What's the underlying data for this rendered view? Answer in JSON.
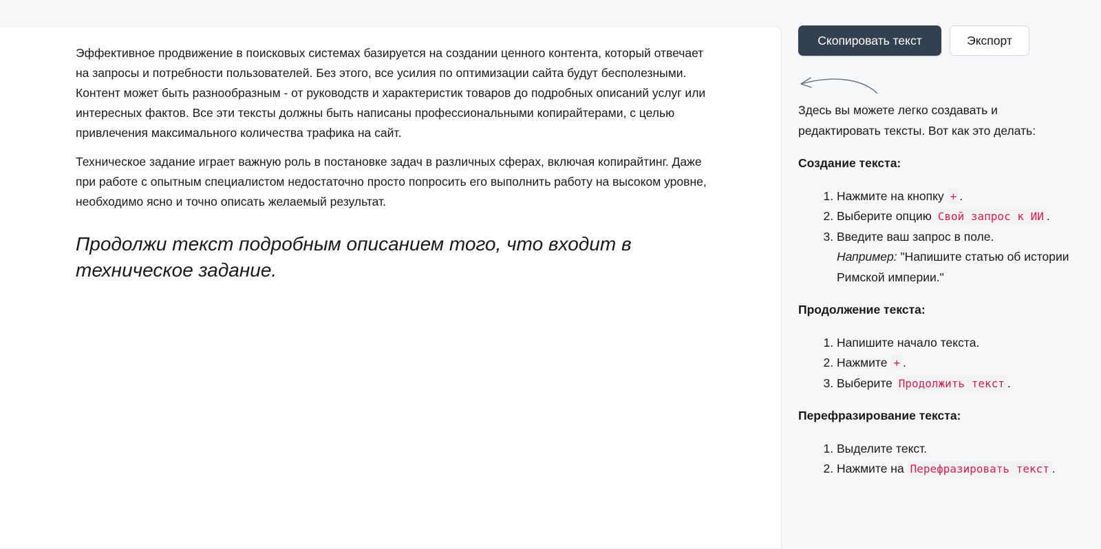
{
  "editor": {
    "paragraphs": [
      "Эффективное продвижение в поисковых системах базируется на создании ценного контента, который отвечает на запросы и потребности пользователей. Без этого, все усилия по оптимизации сайта будут бесполезными. Контент может быть разнообразным - от руководств и характеристик товаров до подробных описаний услуг или интересных фактов. Все эти тексты должны быть написаны профессиональными копирайтерами, с целью привлечения максимального количества трафика на сайт.",
      "Техническое задание играет важную роль в постановке задач в различных сферах, включая копирайтинг. Даже при работе с опытным специалистом недостаточно просто попросить его выполнить работу на высоком уровне, необходимо ясно и точно описать желаемый результат."
    ],
    "prompt": "Продолжи текст подробным описанием того, что входит в техническое задание."
  },
  "toolbar": {
    "copy_label": "Скопировать текст",
    "export_label": "Экспорт",
    "copy_color": "#334050"
  },
  "help": {
    "intro": "Здесь вы можете легко создавать и редактировать тексты. Вот как это делать:",
    "sections": [
      {
        "title": "Создание текста:",
        "steps": [
          {
            "before": "Нажмите на кнопку ",
            "code": "+",
            "after": "."
          },
          {
            "before": "Выберите опцию ",
            "code": "Свой запрос к ИИ",
            "after": "."
          },
          {
            "before": "Введите ваш запрос в поле.",
            "example_label": "Например:",
            "example_text": " \"Напишите статью об истории Римской империи.\""
          }
        ]
      },
      {
        "title": "Продолжение текста:",
        "steps": [
          {
            "before": "Напишите начало текста."
          },
          {
            "before": "Нажмите ",
            "code": "+",
            "after": "."
          },
          {
            "before": "Выберите ",
            "code": "Продолжить текст",
            "after": "."
          }
        ]
      },
      {
        "title": "Перефразирование текста:",
        "steps": [
          {
            "before": "Выделите текст."
          },
          {
            "before": "Нажмите на ",
            "code": "Перефразировать текст",
            "after": "."
          }
        ]
      }
    ],
    "arrow_icon": "curved-arrow-left-icon",
    "code_color": "#d6204e"
  }
}
